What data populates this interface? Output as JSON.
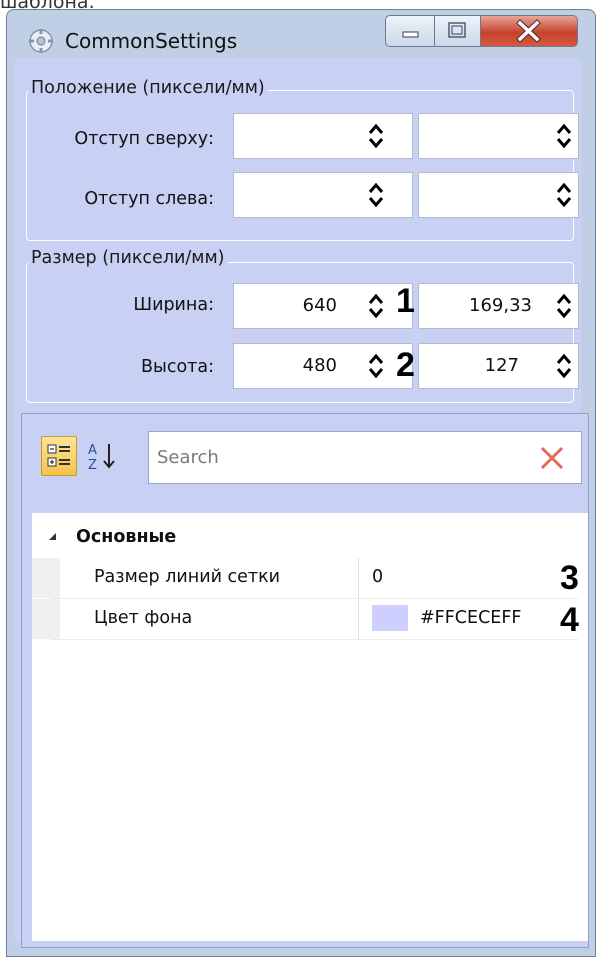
{
  "caption_fragment": "шаблона.",
  "window": {
    "title": "CommonSettings"
  },
  "position_group": {
    "label": "Положение (пиксели/мм)",
    "top_offset_label": "Отступ сверху:",
    "left_offset_label": "Отступ слева:",
    "top_px": "",
    "top_mm": "",
    "left_px": "",
    "left_mm": ""
  },
  "size_group": {
    "label": "Размер (пиксели/мм)",
    "width_label": "Ширина:",
    "height_label": "Высота:",
    "width_px": "640",
    "width_mm": "169,33",
    "height_px": "480",
    "height_mm": "127"
  },
  "markers": [
    "1",
    "2",
    "3",
    "4"
  ],
  "property_grid": {
    "search_placeholder": "Search",
    "category": "Основные",
    "properties": [
      {
        "name": "Размер линий сетки",
        "value": "0"
      },
      {
        "name": "Цвет фона",
        "value": "#FFCECEFF",
        "swatch_color": "#cecfff"
      }
    ]
  },
  "colors": {
    "client_background": "#c8d0f3",
    "close_button": "#c7422c"
  }
}
